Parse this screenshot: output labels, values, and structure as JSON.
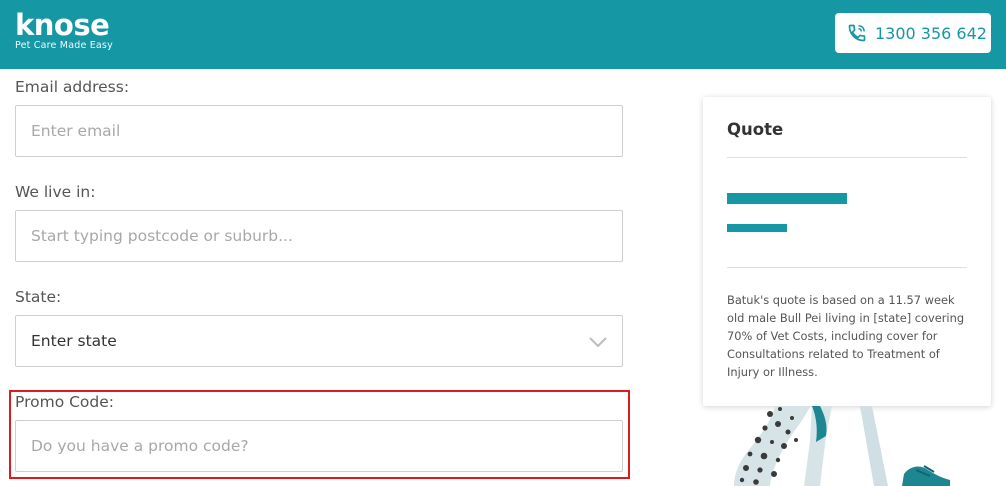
{
  "header": {
    "logo_text": "knose",
    "logo_tagline": "Pet Care Made Easy",
    "phone": "1300 356 642",
    "bg_color": "#1597a4"
  },
  "form": {
    "email": {
      "label": "Email address:",
      "placeholder": "Enter email"
    },
    "location": {
      "label": "We live in:",
      "placeholder": "Start typing postcode or suburb..."
    },
    "state": {
      "label": "State:",
      "value": "Enter state"
    },
    "promo": {
      "label": "Promo Code:",
      "placeholder": "Do you have a promo code?"
    }
  },
  "quote": {
    "title": "Quote",
    "description": "Batuk's quote is based on a 11.57 week old male Bull Pei living in [state] covering 70% of Vet Costs, including cover for Consultations related to Treatment of Injury or Illness."
  },
  "icons": {
    "phone": "phone-icon",
    "state_select": "chevron-down-icon"
  },
  "colors": {
    "accent": "#1597a4",
    "highlight": "#e01919"
  }
}
